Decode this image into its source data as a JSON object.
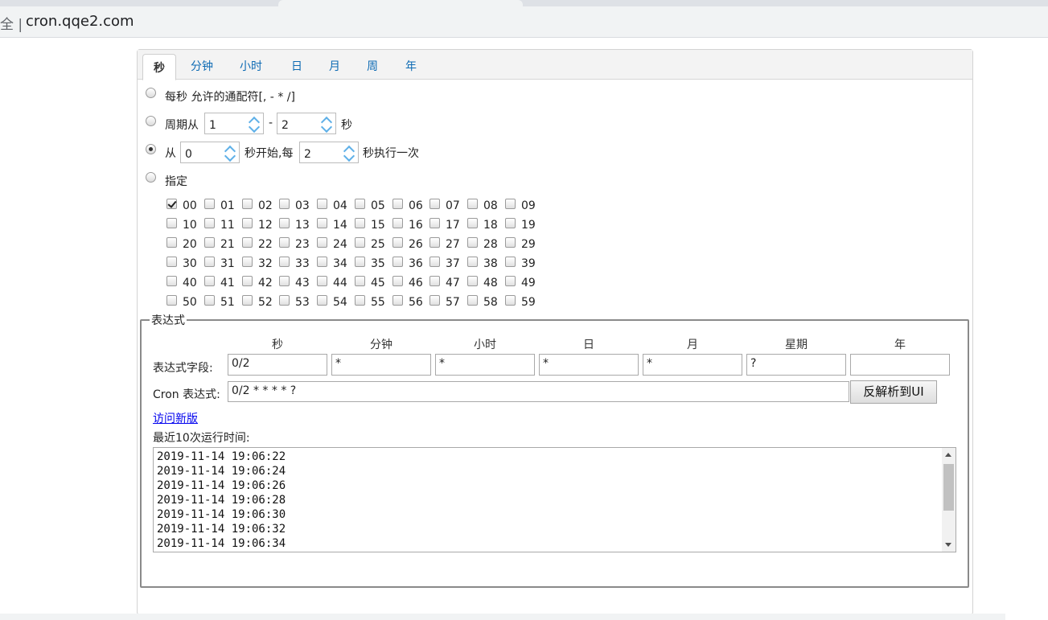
{
  "browser": {
    "security_text": "全 |",
    "url": "cron.qqe2.com"
  },
  "tabs": [
    {
      "label": "秒",
      "active": true
    },
    {
      "label": "分钟"
    },
    {
      "label": "小时"
    },
    {
      "label": "日"
    },
    {
      "label": "月"
    },
    {
      "label": "周"
    },
    {
      "label": "年"
    }
  ],
  "options": {
    "every": "每秒 允许的通配符[, - * /]",
    "period_prefix": "周期从",
    "period_from": "1",
    "period_dash": "-",
    "period_to": "2",
    "period_suffix": "秒",
    "start_prefix": "从",
    "start_value": "0",
    "start_mid": "秒开始,每",
    "step_value": "2",
    "start_suffix": "秒执行一次",
    "specify": "指定"
  },
  "seconds": [
    "00",
    "01",
    "02",
    "03",
    "04",
    "05",
    "06",
    "07",
    "08",
    "09",
    "10",
    "11",
    "12",
    "13",
    "14",
    "15",
    "16",
    "17",
    "18",
    "19",
    "20",
    "21",
    "22",
    "23",
    "24",
    "25",
    "26",
    "27",
    "28",
    "29",
    "30",
    "31",
    "32",
    "33",
    "34",
    "35",
    "36",
    "37",
    "38",
    "39",
    "40",
    "41",
    "42",
    "43",
    "44",
    "45",
    "46",
    "47",
    "48",
    "49",
    "50",
    "51",
    "52",
    "53",
    "54",
    "55",
    "56",
    "57",
    "58",
    "59"
  ],
  "checked_seconds": [
    "00"
  ],
  "expression": {
    "legend": "表达式",
    "columns": [
      "秒",
      "分钟",
      "小时",
      "日",
      "月",
      "星期",
      "年"
    ],
    "field_label": "表达式字段:",
    "fields": [
      "0/2",
      "*",
      "*",
      "*",
      "*",
      "?",
      ""
    ],
    "cron_label": "Cron 表达式:",
    "cron_value": "0/2 * * * * ?",
    "parse_button": "反解析到UI",
    "link": "访问新版",
    "recent_label": "最近10次运行时间:",
    "recent_runs": [
      "2019-11-14 19:06:22",
      "2019-11-14 19:06:24",
      "2019-11-14 19:06:26",
      "2019-11-14 19:06:28",
      "2019-11-14 19:06:30",
      "2019-11-14 19:06:32",
      "2019-11-14 19:06:34"
    ]
  },
  "colors": {
    "accent": "#0e6bb4",
    "spin_arrow": "#5fb0e8",
    "link": "#0000ee"
  }
}
